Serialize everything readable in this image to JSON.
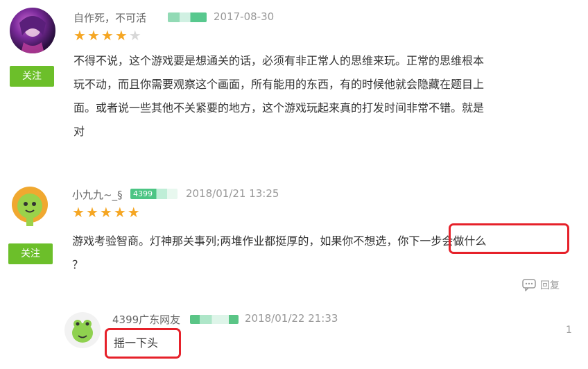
{
  "comments": [
    {
      "username": "自作死，不可活",
      "date": "2017-08-30",
      "follow_label": "关注",
      "rating": 4,
      "max_rating": 5,
      "lines": [
        "不得不说，这个游戏要是想通关的话，必须有非正常人的思维来玩。正常的思维根本",
        "玩不动，而且你需要观察这个画面，所有能用的东西，有的时候他就会隐藏在题目上",
        "面。或者说一些其他不关紧要的地方，这个游戏玩起来真的打发时间非常不错。就是",
        "对"
      ]
    },
    {
      "username": "小九九~_§",
      "badge_text": "4399",
      "date": "2018/01/21 13:25",
      "follow_label": "关注",
      "rating": 5,
      "max_rating": 5,
      "line1_plain": "游戏考验智商。灯神那关事列;两堆作业都挺厚的，如果你不想选，",
      "line1_highlight": "你下一步会做什么",
      "line2": "？",
      "reply_label": "回复"
    }
  ],
  "reply": {
    "username": "4399广东网友",
    "date": "2018/01/22 21:33",
    "text": "摇一下头",
    "floor": "1"
  },
  "colors": {
    "follow_green": "#6cbf2a",
    "star_orange": "#f5a623",
    "highlight_red": "#e6212a"
  }
}
